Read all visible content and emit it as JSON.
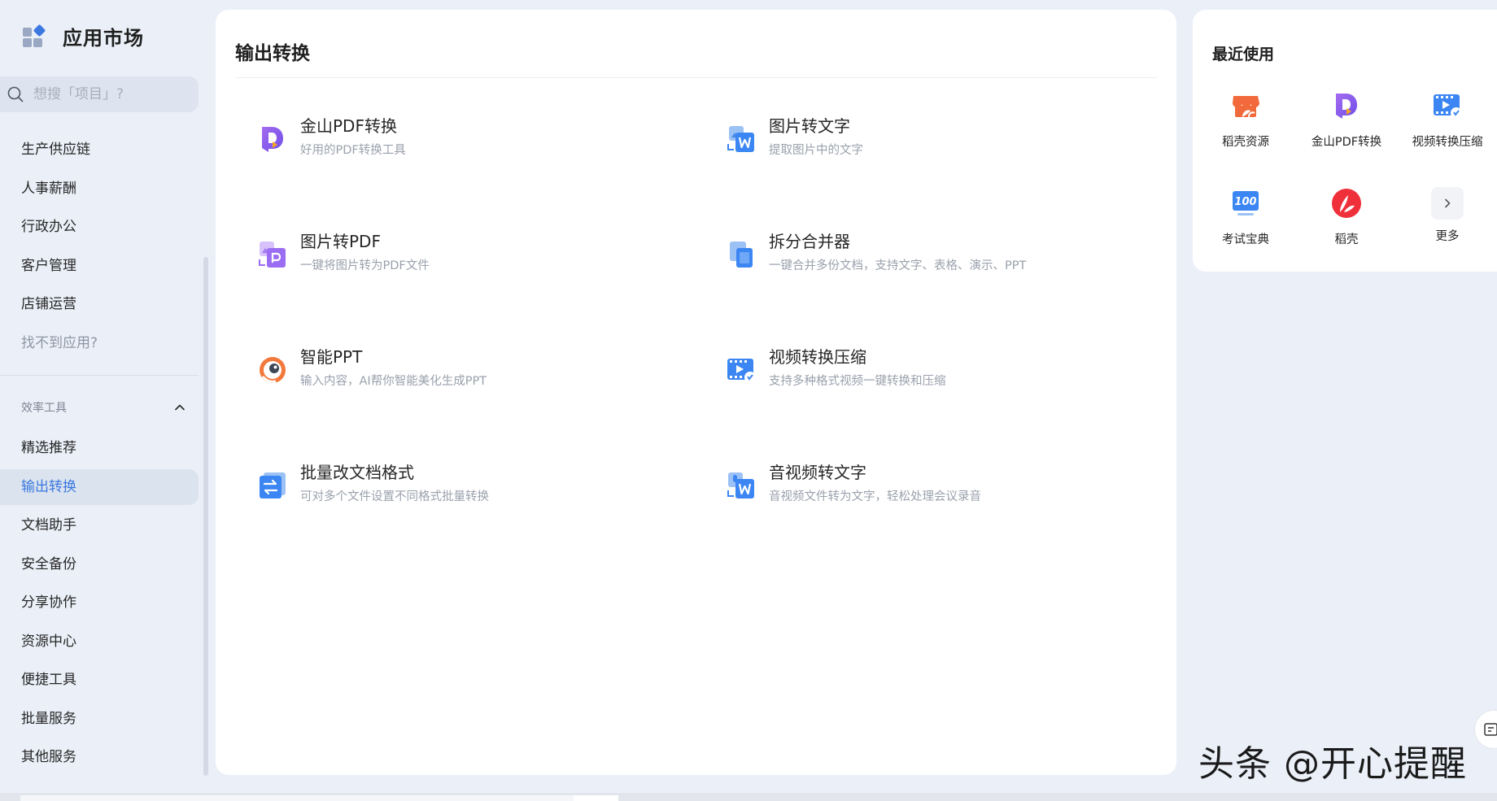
{
  "sidebar": {
    "app_title": "应用市场",
    "search_placeholder": "想搜「项目」?",
    "items_top": [
      {
        "label": "生产供应链"
      },
      {
        "label": "人事薪酬"
      },
      {
        "label": "行政办公"
      },
      {
        "label": "客户管理"
      },
      {
        "label": "店铺运营"
      },
      {
        "label": "找不到应用?"
      }
    ],
    "group_label": "效率工具",
    "items_group": [
      {
        "label": "精选推荐"
      },
      {
        "label": "输出转换"
      },
      {
        "label": "文档助手"
      },
      {
        "label": "安全备份"
      },
      {
        "label": "分享协作"
      },
      {
        "label": "资源中心"
      },
      {
        "label": "便捷工具"
      },
      {
        "label": "批量服务"
      },
      {
        "label": "其他服务"
      }
    ],
    "active_item": "输出转换"
  },
  "main": {
    "title": "输出转换",
    "tools": [
      {
        "name": "金山PDF转换",
        "desc": "好用的PDF转换工具",
        "icon": "pdf-convert-icon"
      },
      {
        "name": "图片转文字",
        "desc": "提取图片中的文字",
        "icon": "image-to-text-icon"
      },
      {
        "name": "图片转PDF",
        "desc": "一键将图片转为PDF文件",
        "icon": "image-to-pdf-icon"
      },
      {
        "name": "拆分合并器",
        "desc": "一键合并多份文档，支持文字、表格、演示、PPT",
        "icon": "split-merge-icon"
      },
      {
        "name": "智能PPT",
        "desc": "输入内容，AI帮你智能美化生成PPT",
        "icon": "smart-ppt-icon"
      },
      {
        "name": "视频转换压缩",
        "desc": "支持多种格式视频一键转换和压缩",
        "icon": "video-compress-icon"
      },
      {
        "name": "批量改文档格式",
        "desc": "可对多个文件设置不同格式批量转换",
        "icon": "batch-format-icon"
      },
      {
        "name": "音视频转文字",
        "desc": "音视频文件转为文字，轻松处理会议录音",
        "icon": "audio-to-text-icon"
      }
    ]
  },
  "recent": {
    "title": "最近使用",
    "items": [
      {
        "label": "稻壳资源",
        "icon": "docer-store-icon"
      },
      {
        "label": "金山PDF转换",
        "icon": "pdf-convert-icon"
      },
      {
        "label": "视频转换压缩",
        "icon": "video-compress-icon"
      },
      {
        "label": "考试宝典",
        "icon": "exam-icon"
      },
      {
        "label": "稻壳",
        "icon": "docer-icon"
      },
      {
        "label": "更多",
        "icon": "chevron-right-icon"
      }
    ]
  },
  "watermark": "头条 @开心提醒",
  "colors": {
    "accent": "#3b78e0",
    "background": "#ebf0f8",
    "panel": "#ffffff",
    "muted_text": "#9aa1ac"
  }
}
